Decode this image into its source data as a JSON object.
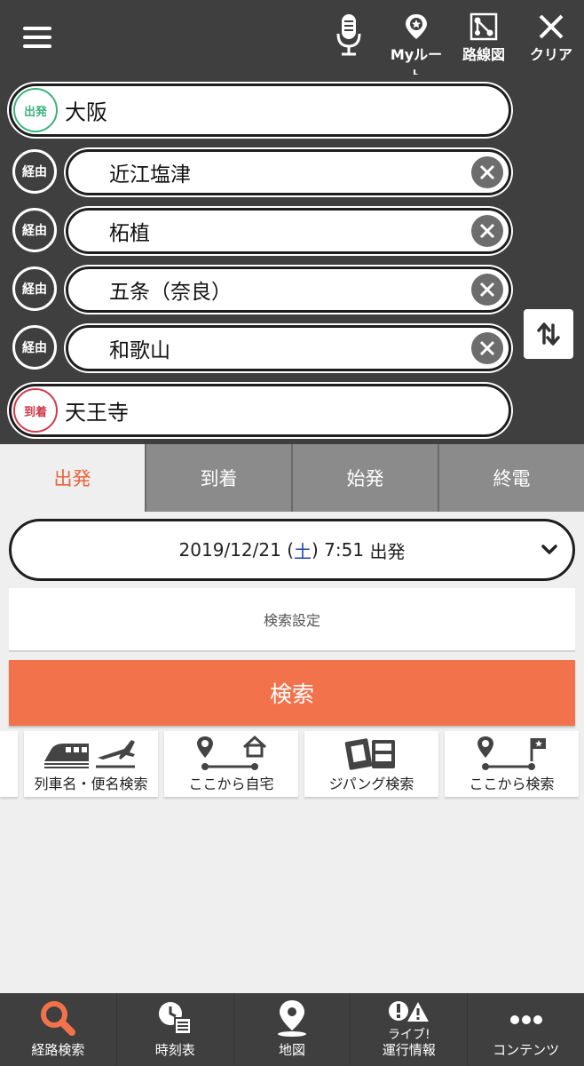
{
  "header": {
    "menu_icon": "hamburger-menu-icon",
    "voice_icon": "microphone-icon",
    "myroute_label": "Myルート",
    "routemap_label": "路線図",
    "clear_label": "クリア"
  },
  "route": {
    "departure": {
      "badge": "出発",
      "name": "大阪"
    },
    "vias": [
      {
        "badge": "経由",
        "name": "近江塩津"
      },
      {
        "badge": "経由",
        "name": "柘植"
      },
      {
        "badge": "経由",
        "name": "五条（奈良）"
      },
      {
        "badge": "経由",
        "name": "和歌山"
      }
    ],
    "arrival": {
      "badge": "到着",
      "name": "天王寺"
    },
    "colors": {
      "departure": "#3bb37c",
      "arrival": "#d03b4a"
    }
  },
  "tabs": [
    {
      "label": "出発",
      "active": true
    },
    {
      "label": "到着",
      "active": false
    },
    {
      "label": "始発",
      "active": false
    },
    {
      "label": "終電",
      "active": false
    }
  ],
  "datetime": {
    "date": "2019/12/21",
    "dow_open": "(",
    "dow": "土",
    "dow_close": ")",
    "time": "7:51",
    "mode": "出発"
  },
  "settings_label": "検索設定",
  "search_label": "検索",
  "shortcuts": [
    {
      "label": "列車名・便名検索",
      "icon": "train-plane-icon"
    },
    {
      "label": "ここから自宅",
      "icon": "route-home-icon"
    },
    {
      "label": "ジパング検索",
      "icon": "ticket-icon"
    },
    {
      "label": "ここから検索",
      "icon": "route-flag-icon"
    }
  ],
  "bottom_nav": [
    {
      "label": "経路検索",
      "icon": "search-icon",
      "active": true
    },
    {
      "label": "時刻表",
      "icon": "timetable-icon"
    },
    {
      "label": "地図",
      "icon": "map-pin-icon"
    },
    {
      "label_top": "ライブ!",
      "label": "運行情報",
      "icon": "alert-icon"
    },
    {
      "label": "コンテンツ",
      "icon": "more-dots-icon"
    }
  ],
  "accent_color": "#f2734b"
}
